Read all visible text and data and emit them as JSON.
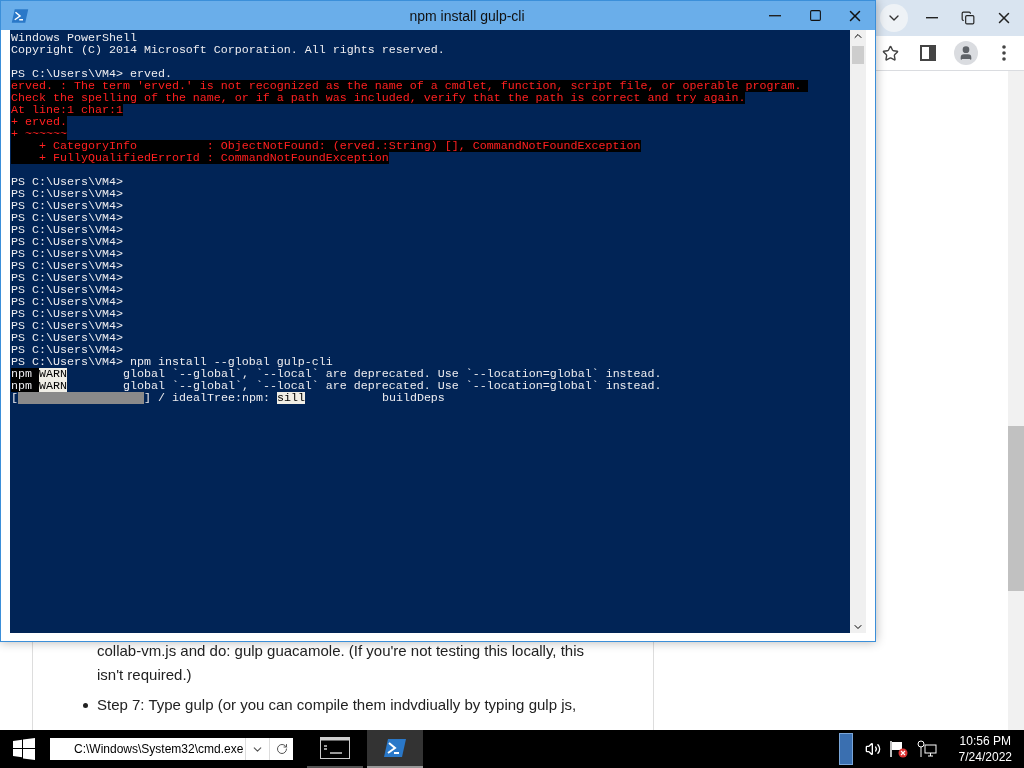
{
  "console_window": {
    "title": "npm install gulp-cli",
    "lines": [
      {
        "kind": "normal",
        "text": "Windows PowerShell"
      },
      {
        "kind": "normal",
        "text": "Copyright (C) 2014 Microsoft Corporation. All rights reserved."
      },
      {
        "kind": "blank"
      },
      {
        "kind": "normal",
        "text": "PS C:\\Users\\VM4> erved."
      },
      {
        "kind": "error",
        "text": "erved. : The term 'erved.' is not recognized as the name of a cmdlet, function, script file, or operable program. "
      },
      {
        "kind": "error",
        "text": "Check the spelling of the name, or if a path was included, verify that the path is correct and try again."
      },
      {
        "kind": "error",
        "text": "At line:1 char:1"
      },
      {
        "kind": "error",
        "text": "+ erved."
      },
      {
        "kind": "error",
        "text": "+ ~~~~~~"
      },
      {
        "kind": "error",
        "text": "    + CategoryInfo          : ObjectNotFound: (erved.:String) [], CommandNotFoundException"
      },
      {
        "kind": "error",
        "text": "    + FullyQualifiedErrorId : CommandNotFoundException"
      },
      {
        "kind": "blank"
      },
      {
        "kind": "normal",
        "text": "PS C:\\Users\\VM4>"
      },
      {
        "kind": "normal",
        "text": "PS C:\\Users\\VM4>"
      },
      {
        "kind": "normal",
        "text": "PS C:\\Users\\VM4>"
      },
      {
        "kind": "normal",
        "text": "PS C:\\Users\\VM4>"
      },
      {
        "kind": "normal",
        "text": "PS C:\\Users\\VM4>"
      },
      {
        "kind": "normal",
        "text": "PS C:\\Users\\VM4>"
      },
      {
        "kind": "normal",
        "text": "PS C:\\Users\\VM4>"
      },
      {
        "kind": "normal",
        "text": "PS C:\\Users\\VM4>"
      },
      {
        "kind": "normal",
        "text": "PS C:\\Users\\VM4>"
      },
      {
        "kind": "normal",
        "text": "PS C:\\Users\\VM4>"
      },
      {
        "kind": "normal",
        "text": "PS C:\\Users\\VM4>"
      },
      {
        "kind": "normal",
        "text": "PS C:\\Users\\VM4>"
      },
      {
        "kind": "normal",
        "text": "PS C:\\Users\\VM4>"
      },
      {
        "kind": "normal",
        "text": "PS C:\\Users\\VM4>"
      },
      {
        "kind": "normal",
        "text": "PS C:\\Users\\VM4>"
      },
      {
        "kind": "normal",
        "text": "PS C:\\Users\\VM4> npm install --global gulp-cli"
      },
      {
        "kind": "warn",
        "prefix": "npm",
        "tag": "WARN",
        "text": "global `--global`, `--local` are deprecated. Use `--location=global` instead."
      },
      {
        "kind": "warn",
        "prefix": "npm",
        "tag": "WARN",
        "text": "global `--global`, `--local` are deprecated. Use `--location=global` instead."
      },
      {
        "kind": "progress",
        "open": "[",
        "level": 1,
        "text": "] / idealTree:npm:",
        "tag": "sill",
        "detail": "buildDeps"
      }
    ]
  },
  "article": {
    "items": [
      {
        "kind": "continuation",
        "text": "collab-vm.js and do: gulp guacamole. (If you're not testing this locally, this isn't required.)"
      },
      {
        "kind": "bullet",
        "text": "Step 7: Type gulp (or you can compile them indvdiually by typing gulp js,"
      }
    ]
  },
  "taskbar": {
    "address": "C:\\Windows\\System32\\cmd.exe",
    "apps": [
      {
        "kind": "cmd",
        "selected": false
      },
      {
        "kind": "powershell",
        "selected": true
      }
    ],
    "time": "10:56 PM",
    "date": "7/24/2022"
  }
}
